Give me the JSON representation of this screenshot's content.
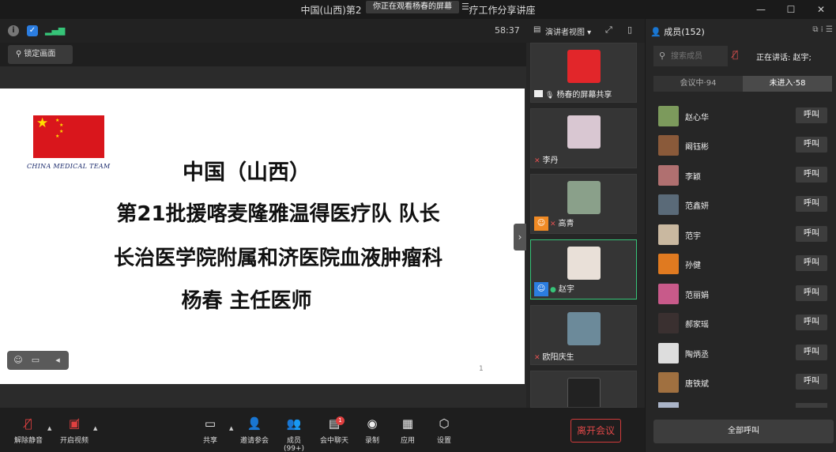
{
  "window": {
    "title": "中国(山西)第2",
    "title_tail": "疗工作分享讲座",
    "viewing_badge": "你正在观看杨春的屏幕",
    "badge_menu_icon": "☰",
    "controls": [
      "—",
      "☐",
      "✕"
    ]
  },
  "meeting_bar": {
    "timer": "58:37",
    "lock_label": "锁定画面"
  },
  "slide": {
    "team": "CHINA MEDICAL TEAM",
    "lines": [
      "中国（山西）",
      "第21批援喀麦隆雅温得医疗队  队长",
      "长治医学院附属和济医院血液肿瘤科",
      "杨春  主任医师"
    ],
    "page": "1"
  },
  "strip": {
    "view_label": "演讲者视图",
    "tiles": [
      {
        "name": "杨春的屏幕共享",
        "color": "#e2262a"
      },
      {
        "name": "李丹",
        "color": "#d9c7d2"
      },
      {
        "name": "高青",
        "color": "#8aa08a"
      },
      {
        "name": "赵宇",
        "color": "#e9e0d8"
      },
      {
        "name": "欧阳庆生",
        "color": "#6c8a9a"
      },
      {
        "name": "",
        "color": "#222222"
      }
    ]
  },
  "panel": {
    "title": "成员(152)",
    "search_placeholder": "搜索成员",
    "speaking": "正在讲话: 赵宇;",
    "tabs": [
      "会议中·94",
      "未进入·58"
    ],
    "call_label": "呼叫",
    "call_all": "全部呼叫",
    "members": [
      {
        "name": "赵心华",
        "color": "#7c9a5c"
      },
      {
        "name": "阚钰彬",
        "color": "#8a5a3a"
      },
      {
        "name": "李颖",
        "color": "#b07070"
      },
      {
        "name": "范鑫妍",
        "color": "#5a6a78"
      },
      {
        "name": "范宇",
        "color": "#c9b8a0"
      },
      {
        "name": "孙健",
        "color": "#e07a20"
      },
      {
        "name": "范丽娟",
        "color": "#c85a8a"
      },
      {
        "name": "郝家瑶",
        "color": "#3a3030"
      },
      {
        "name": "陶炳丞",
        "color": "#dddddd"
      },
      {
        "name": "唐铁斌",
        "color": "#a07040"
      }
    ]
  },
  "toolbar": {
    "unmute": "解除静音",
    "video": "开启视频",
    "share": "共享",
    "invite": "邀请参会",
    "members": "成员(99+)",
    "chat": "会中聊天",
    "chat_badge": "1",
    "record": "录制",
    "apps": "应用",
    "settings": "设置",
    "leave": "离开会议"
  }
}
